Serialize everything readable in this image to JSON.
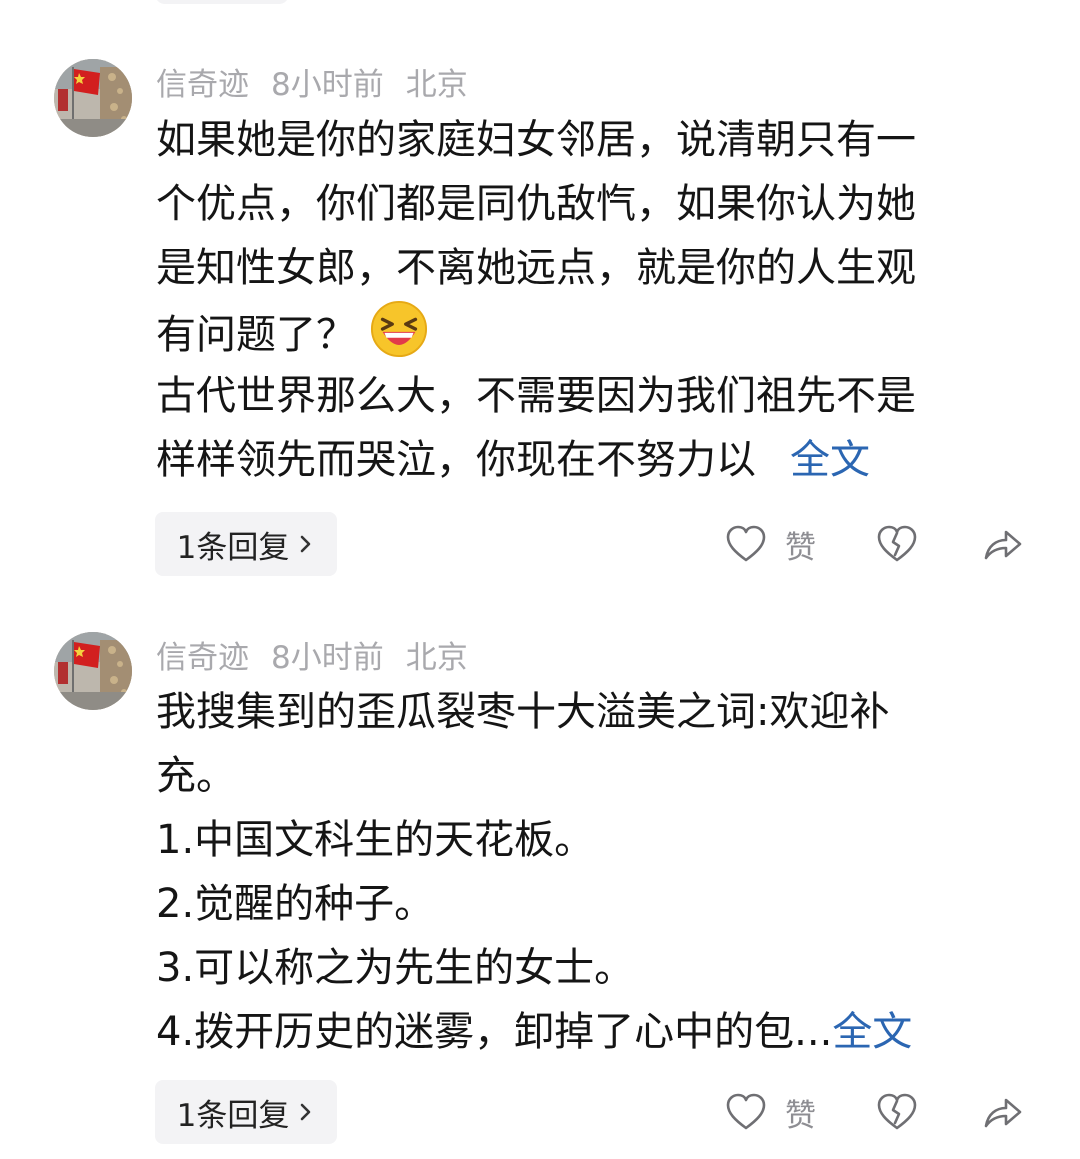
{
  "comments": [
    {
      "username": "信奇迹",
      "time": "8小时前",
      "location": "北京",
      "lines": [
        "如果她是你的家庭妇女邻居，说清朝只有一",
        "个优点，你们都是同仇敌忾，如果你认为她",
        "是知性女郎，不离她远点，就是你的人生观",
        "有问题了？"
      ],
      "extra_lines": [
        "古代世界那么大，不需要因为我们祖先不是"
      ],
      "last_line": "样样领先而哭泣，你现在不努力以",
      "full_text_label": "全文",
      "reply_label": "1条回复",
      "like_label": "赞"
    },
    {
      "username": "信奇迹",
      "time": "8小时前",
      "location": "北京",
      "lines": [
        "我搜集到的歪瓜裂枣十大溢美之词:欢迎补",
        "充。",
        "1.中国文科生的天花板。",
        "2.觉醒的种子。",
        "3.可以称之为先生的女士。"
      ],
      "last_line": "4.拨开历史的迷雾，卸掉了心中的包...",
      "full_text_label": "全文",
      "reply_label": "1条回复",
      "like_label": "赞"
    }
  ],
  "icons": {
    "emoji": "grinning-squinting-face-icon",
    "like": "heart-outline-icon",
    "dislike": "broken-heart-icon",
    "share": "share-arrow-icon",
    "chevron": "chevron-right-icon"
  },
  "colors": {
    "meta": "#a9a9ad",
    "body_text": "#151515",
    "link": "#2b66b2",
    "button_bg": "#f3f3f5"
  }
}
